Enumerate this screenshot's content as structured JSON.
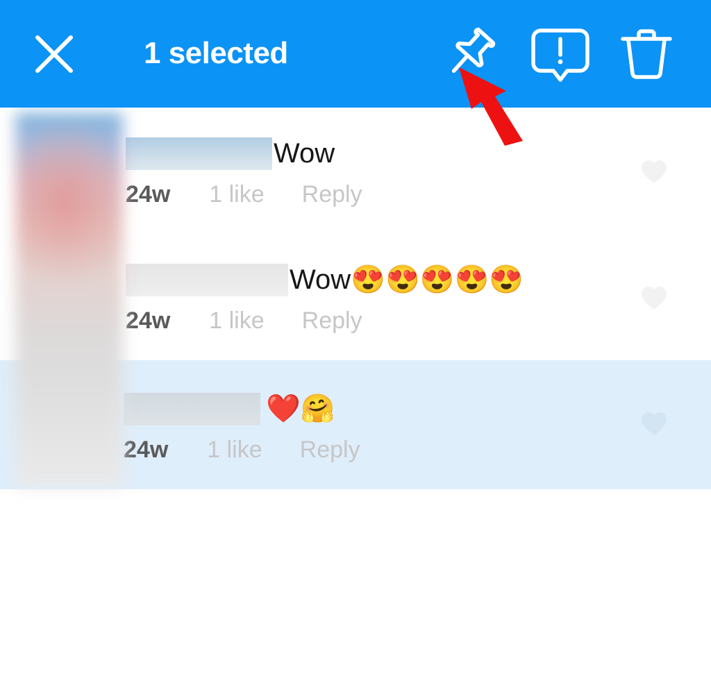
{
  "action_bar": {
    "background_color": "#0B93F6",
    "title": "1 selected",
    "close_icon": "close-x-icon",
    "actions": [
      {
        "id": "pin",
        "icon": "pushpin-icon",
        "label": "Pin comment"
      },
      {
        "id": "report",
        "icon": "report-speech-bubble-exclamation-icon",
        "label": "Report comment"
      },
      {
        "id": "delete",
        "icon": "trash-can-icon",
        "label": "Delete comment"
      }
    ]
  },
  "annotation": {
    "type": "arrow",
    "color": "#EE1111",
    "points_to": "pin"
  },
  "comments": [
    {
      "username_redacted": true,
      "redaction_width": 211,
      "redaction_style": "blue",
      "text": "Wow",
      "emoji": "",
      "age": "24w",
      "likes": "1 like",
      "reply": "Reply",
      "selected": false,
      "like_icon": "heart-outline-icon"
    },
    {
      "username_redacted": true,
      "redaction_width": 234,
      "redaction_style": "grey",
      "text": "Wow",
      "emoji": "😍😍😍😍😍",
      "age": "24w",
      "likes": "1 like",
      "reply": "Reply",
      "selected": false,
      "like_icon": "heart-outline-icon"
    },
    {
      "username_redacted": true,
      "redaction_width": 197,
      "redaction_style": "bluegrey",
      "text": "",
      "emoji": "❤️🤗",
      "age": "24w",
      "likes": "1 like",
      "reply": "Reply",
      "selected": true,
      "like_icon": "heart-outline-icon"
    }
  ],
  "selection": {
    "highlight_color": "#DFEEFB",
    "count": 1
  }
}
